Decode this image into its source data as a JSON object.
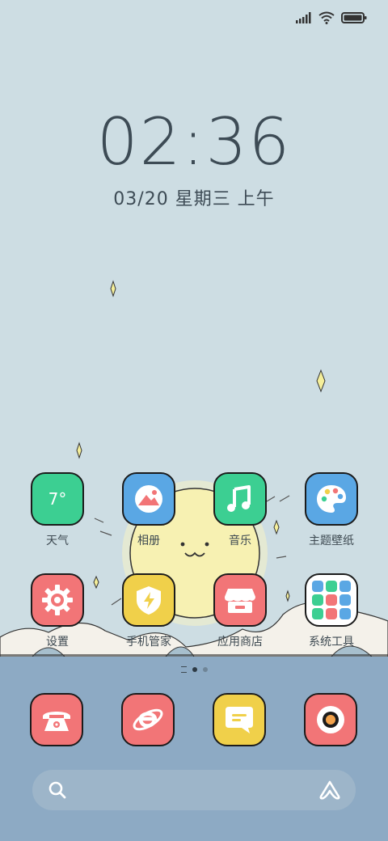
{
  "status_bar": {
    "signal_icon": "signal-bars-icon",
    "wifi_icon": "wifi-icon",
    "battery_icon": "battery-icon",
    "battery_level": 1.0
  },
  "lockclock": {
    "time": "02:36",
    "date": "03/20 星期三 上午"
  },
  "apps": [
    {
      "id": "weather",
      "label": "天气",
      "badge": "7°",
      "color": "#3ccf92",
      "icon": "weather-icon"
    },
    {
      "id": "gallery",
      "label": "相册",
      "color": "#5aa7e4",
      "icon": "gallery-icon"
    },
    {
      "id": "music",
      "label": "音乐",
      "color": "#3ccf92",
      "icon": "music-note-icon"
    },
    {
      "id": "themes",
      "label": "主题壁纸",
      "color": "#5aa7e4",
      "icon": "palette-icon"
    },
    {
      "id": "settings",
      "label": "设置",
      "color": "#f27577",
      "icon": "gear-icon"
    },
    {
      "id": "security",
      "label": "手机管家",
      "color": "#f0d04a",
      "icon": "shield-icon"
    },
    {
      "id": "appstore",
      "label": "应用商店",
      "color": "#f27577",
      "icon": "store-icon"
    },
    {
      "id": "tools",
      "label": "系统工具",
      "color": "#ffffff",
      "icon": "folder-icon"
    }
  ],
  "dock": [
    {
      "id": "phone",
      "color": "#f27577",
      "icon": "phone-icon"
    },
    {
      "id": "browser",
      "color": "#f27577",
      "icon": "browser-icon"
    },
    {
      "id": "messages",
      "color": "#f0d04a",
      "icon": "message-icon"
    },
    {
      "id": "camera",
      "color": "#f27577",
      "icon": "camera-icon"
    }
  ],
  "page_indicator": {
    "pages": 2,
    "current": 1
  },
  "search": {
    "search_icon": "search-icon",
    "assistant_icon": "assistant-icon"
  }
}
